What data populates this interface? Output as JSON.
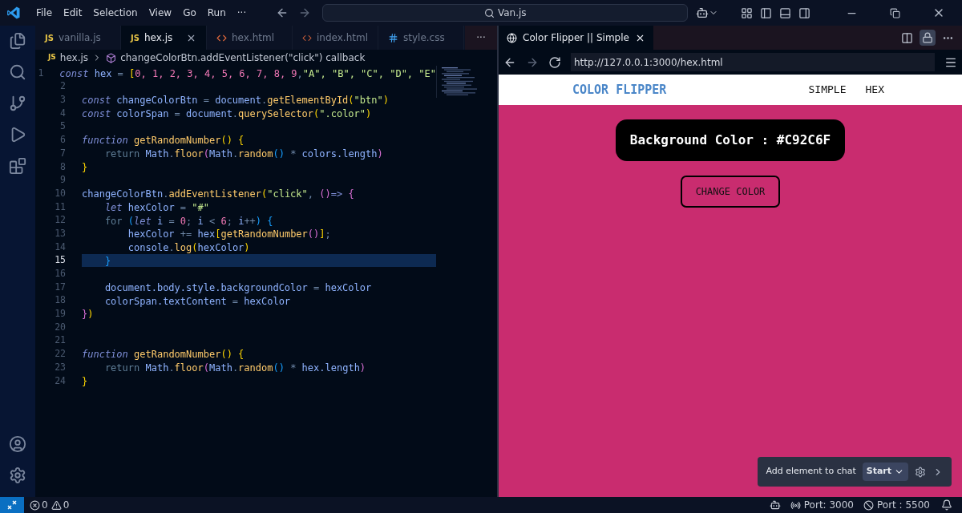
{
  "title_bar": {
    "menus": [
      "File",
      "Edit",
      "Selection",
      "View",
      "Go",
      "Run",
      "···"
    ],
    "search": "Van.js"
  },
  "editor": {
    "tabs": [
      {
        "label": "vanilla.js",
        "kind": "js",
        "badge": "JS",
        "selected": false
      },
      {
        "label": "hex.js",
        "kind": "js",
        "badge": "JS",
        "selected": true
      },
      {
        "label": "hex.html",
        "kind": "html",
        "selected": false
      },
      {
        "label": "index.html",
        "kind": "html",
        "selected": false
      },
      {
        "label": "style.css",
        "kind": "css",
        "selected": false
      }
    ],
    "more": "···",
    "breadcrumb": {
      "badge": "JS",
      "file": "hex.js",
      "symbol": "changeColorBtn.addEventListener(\"click\") callback"
    },
    "lines": [
      {
        "number": "1",
        "selected": false,
        "tokens": [
          {
            "text": "const",
            "kind": "kw"
          },
          {
            "text": " hex ",
            "kind": "var"
          },
          {
            "text": "= ",
            "kind": "op"
          },
          {
            "text": "[",
            "kind": "p1"
          },
          {
            "text": "0, 1, 2, 3, 4, 5, 6, 7, 8, 9",
            "kind": "num"
          },
          {
            "text": ",",
            "kind": "op"
          },
          {
            "text": "\"A\", \"B\", \"C\", \"D\", \"E\"",
            "kind": "str"
          }
        ]
      },
      {
        "number": "2",
        "selected": false
      },
      {
        "number": "3",
        "selected": false,
        "tokens": [
          {
            "text": "const",
            "kind": "kw"
          },
          {
            "text": " changeColorBtn ",
            "kind": "var"
          },
          {
            "text": "= ",
            "kind": "op"
          },
          {
            "text": "document",
            "kind": "var"
          },
          {
            "text": ".",
            "kind": "op"
          },
          {
            "text": "getElementById",
            "kind": "fn"
          },
          {
            "text": "(",
            "kind": "p1"
          },
          {
            "text": "\"btn\"",
            "kind": "str"
          },
          {
            "text": ")",
            "kind": "p1"
          }
        ]
      },
      {
        "number": "4",
        "selected": false,
        "tokens": [
          {
            "text": "const",
            "kind": "kw"
          },
          {
            "text": " colorSpan ",
            "kind": "var"
          },
          {
            "text": "= ",
            "kind": "op"
          },
          {
            "text": "document",
            "kind": "var"
          },
          {
            "text": ".",
            "kind": "op"
          },
          {
            "text": "querySelector",
            "kind": "fn"
          },
          {
            "text": "(",
            "kind": "p1"
          },
          {
            "text": "\".color\"",
            "kind": "str"
          },
          {
            "text": ")",
            "kind": "p1"
          }
        ]
      },
      {
        "number": "5",
        "selected": false
      },
      {
        "number": "6",
        "selected": false,
        "tokens": [
          {
            "text": "function ",
            "kind": "kw"
          },
          {
            "text": "getRandomNumber",
            "kind": "fn"
          },
          {
            "text": "() {",
            "kind": "p1"
          }
        ]
      },
      {
        "number": "7",
        "selected": false,
        "tokens": [
          {
            "text": "    return",
            "kind": "ctl"
          },
          {
            "text": " Math",
            "kind": "var"
          },
          {
            "text": ".",
            "kind": "op"
          },
          {
            "text": "floor",
            "kind": "fn"
          },
          {
            "text": "(",
            "kind": "p2"
          },
          {
            "text": "Math",
            "kind": "var"
          },
          {
            "text": ".",
            "kind": "op"
          },
          {
            "text": "random",
            "kind": "fn"
          },
          {
            "text": "()",
            "kind": "p3"
          },
          {
            "text": " * ",
            "kind": "op"
          },
          {
            "text": "colors.length",
            "kind": "var"
          },
          {
            "text": ")",
            "kind": "p2"
          }
        ]
      },
      {
        "number": "8",
        "selected": false,
        "tokens": [
          {
            "text": "}",
            "kind": "p1"
          }
        ]
      },
      {
        "number": "9",
        "selected": false
      },
      {
        "number": "10",
        "selected": false,
        "tokens": [
          {
            "text": "changeColorBtn",
            "kind": "var"
          },
          {
            "text": ".",
            "kind": "op"
          },
          {
            "text": "addEventListener",
            "kind": "fn"
          },
          {
            "text": "(",
            "kind": "p1"
          },
          {
            "text": "\"click\"",
            "kind": "str"
          },
          {
            "text": ", ",
            "kind": "op"
          },
          {
            "text": "()",
            "kind": "p2"
          },
          {
            "text": "=> ",
            "kind": "kw"
          },
          {
            "text": "{",
            "kind": "p2"
          }
        ]
      },
      {
        "number": "11",
        "selected": false,
        "tokens": [
          {
            "text": "    let",
            "kind": "kw"
          },
          {
            "text": " hexColor ",
            "kind": "var"
          },
          {
            "text": "= ",
            "kind": "op"
          },
          {
            "text": "\"#\"",
            "kind": "str"
          }
        ]
      },
      {
        "number": "12",
        "selected": false,
        "tokens": [
          {
            "text": "    for ",
            "kind": "ctl"
          },
          {
            "text": "(",
            "kind": "p3"
          },
          {
            "text": "let",
            "kind": "kw"
          },
          {
            "text": " i ",
            "kind": "var"
          },
          {
            "text": "= ",
            "kind": "op"
          },
          {
            "text": "0",
            "kind": "num"
          },
          {
            "text": "; ",
            "kind": "op"
          },
          {
            "text": "i ",
            "kind": "var"
          },
          {
            "text": "< ",
            "kind": "op"
          },
          {
            "text": "6",
            "kind": "num"
          },
          {
            "text": "; ",
            "kind": "op"
          },
          {
            "text": "i",
            "kind": "var"
          },
          {
            "text": "++",
            "kind": "op"
          },
          {
            "text": ") {",
            "kind": "p3"
          }
        ]
      },
      {
        "number": "13",
        "selected": false,
        "tokens": [
          {
            "text": "        hexColor ",
            "kind": "var"
          },
          {
            "text": "+= ",
            "kind": "op"
          },
          {
            "text": "hex",
            "kind": "var"
          },
          {
            "text": "[",
            "kind": "p1"
          },
          {
            "text": "getRandomNumber",
            "kind": "fn"
          },
          {
            "text": "()",
            "kind": "p2"
          },
          {
            "text": "]",
            "kind": "p1"
          },
          {
            "text": ";",
            "kind": "op"
          }
        ]
      },
      {
        "number": "14",
        "selected": false,
        "tokens": [
          {
            "text": "        console",
            "kind": "var"
          },
          {
            "text": ".",
            "kind": "op"
          },
          {
            "text": "log",
            "kind": "fn"
          },
          {
            "text": "(",
            "kind": "p1"
          },
          {
            "text": "hexColor",
            "kind": "var"
          },
          {
            "text": ")",
            "kind": "p1"
          }
        ]
      },
      {
        "number": "15",
        "selected": true,
        "tokens": [
          {
            "text": "    }",
            "kind": "p3"
          }
        ]
      },
      {
        "number": "16",
        "selected": false
      },
      {
        "number": "17",
        "selected": false,
        "tokens": [
          {
            "text": "    document.body.style.backgroundColor ",
            "kind": "var"
          },
          {
            "text": "= ",
            "kind": "op"
          },
          {
            "text": "hexColor",
            "kind": "var"
          }
        ]
      },
      {
        "number": "18",
        "selected": false,
        "tokens": [
          {
            "text": "    colorSpan.textContent ",
            "kind": "var"
          },
          {
            "text": "= ",
            "kind": "op"
          },
          {
            "text": "hexColor",
            "kind": "var"
          }
        ]
      },
      {
        "number": "19",
        "selected": false,
        "tokens": [
          {
            "text": "}",
            "kind": "p2"
          },
          {
            "text": ")",
            "kind": "p1"
          }
        ]
      },
      {
        "number": "20",
        "selected": false
      },
      {
        "number": "21",
        "selected": false
      },
      {
        "number": "22",
        "selected": false,
        "tokens": [
          {
            "text": "function ",
            "kind": "kw"
          },
          {
            "text": "getRandomNumber",
            "kind": "fn"
          },
          {
            "text": "() {",
            "kind": "p1"
          }
        ]
      },
      {
        "number": "23",
        "selected": false,
        "tokens": [
          {
            "text": "    return",
            "kind": "ctl"
          },
          {
            "text": " Math",
            "kind": "var"
          },
          {
            "text": ".",
            "kind": "op"
          },
          {
            "text": "floor",
            "kind": "fn"
          },
          {
            "text": "(",
            "kind": "p2"
          },
          {
            "text": "Math",
            "kind": "var"
          },
          {
            "text": ".",
            "kind": "op"
          },
          {
            "text": "random",
            "kind": "fn"
          },
          {
            "text": "()",
            "kind": "p3"
          },
          {
            "text": " * ",
            "kind": "op"
          },
          {
            "text": "hex.length",
            "kind": "var"
          },
          {
            "text": ")",
            "kind": "p2"
          }
        ]
      },
      {
        "number": "24",
        "selected": false,
        "tokens": [
          {
            "text": "}",
            "kind": "p1"
          }
        ]
      }
    ]
  },
  "browser": {
    "tab": "Color Flipper || Simple",
    "url": "http://127.0.0.1:3000/hex.html",
    "page": {
      "brand": "COLOR FLIPPER",
      "nav": [
        "SIMPLE",
        "HEX"
      ],
      "color_label": "Background Color : #C92C6F",
      "button": "CHANGE COLOR"
    }
  },
  "chat_toolbar": {
    "label": "Add element to chat",
    "start": "Start"
  },
  "status_bar": {
    "errors": "0",
    "warnings": "0",
    "ports": [
      "Port: 3000",
      "Port : 5500"
    ]
  }
}
